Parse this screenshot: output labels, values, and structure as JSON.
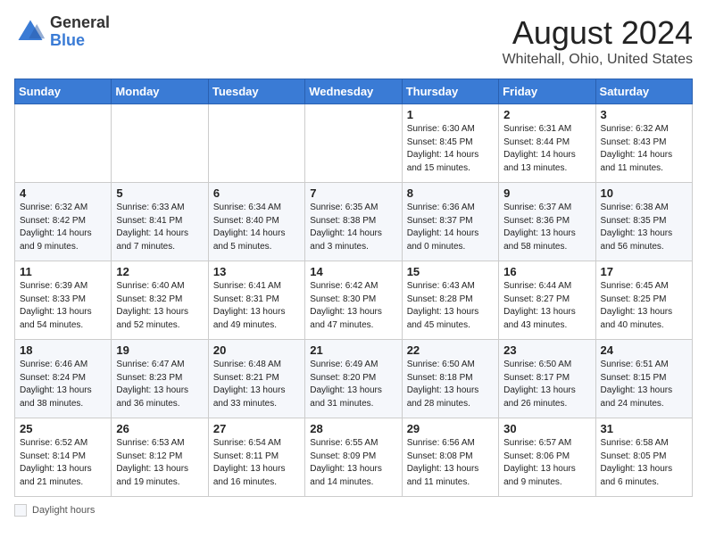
{
  "header": {
    "logo_general": "General",
    "logo_blue": "Blue",
    "title": "August 2024",
    "subtitle": "Whitehall, Ohio, United States"
  },
  "days_of_week": [
    "Sunday",
    "Monday",
    "Tuesday",
    "Wednesday",
    "Thursday",
    "Friday",
    "Saturday"
  ],
  "weeks": [
    [
      {
        "date": "",
        "info": ""
      },
      {
        "date": "",
        "info": ""
      },
      {
        "date": "",
        "info": ""
      },
      {
        "date": "",
        "info": ""
      },
      {
        "date": "1",
        "info": "Sunrise: 6:30 AM\nSunset: 8:45 PM\nDaylight: 14 hours\nand 15 minutes."
      },
      {
        "date": "2",
        "info": "Sunrise: 6:31 AM\nSunset: 8:44 PM\nDaylight: 14 hours\nand 13 minutes."
      },
      {
        "date": "3",
        "info": "Sunrise: 6:32 AM\nSunset: 8:43 PM\nDaylight: 14 hours\nand 11 minutes."
      }
    ],
    [
      {
        "date": "4",
        "info": "Sunrise: 6:32 AM\nSunset: 8:42 PM\nDaylight: 14 hours\nand 9 minutes."
      },
      {
        "date": "5",
        "info": "Sunrise: 6:33 AM\nSunset: 8:41 PM\nDaylight: 14 hours\nand 7 minutes."
      },
      {
        "date": "6",
        "info": "Sunrise: 6:34 AM\nSunset: 8:40 PM\nDaylight: 14 hours\nand 5 minutes."
      },
      {
        "date": "7",
        "info": "Sunrise: 6:35 AM\nSunset: 8:38 PM\nDaylight: 14 hours\nand 3 minutes."
      },
      {
        "date": "8",
        "info": "Sunrise: 6:36 AM\nSunset: 8:37 PM\nDaylight: 14 hours\nand 0 minutes."
      },
      {
        "date": "9",
        "info": "Sunrise: 6:37 AM\nSunset: 8:36 PM\nDaylight: 13 hours\nand 58 minutes."
      },
      {
        "date": "10",
        "info": "Sunrise: 6:38 AM\nSunset: 8:35 PM\nDaylight: 13 hours\nand 56 minutes."
      }
    ],
    [
      {
        "date": "11",
        "info": "Sunrise: 6:39 AM\nSunset: 8:33 PM\nDaylight: 13 hours\nand 54 minutes."
      },
      {
        "date": "12",
        "info": "Sunrise: 6:40 AM\nSunset: 8:32 PM\nDaylight: 13 hours\nand 52 minutes."
      },
      {
        "date": "13",
        "info": "Sunrise: 6:41 AM\nSunset: 8:31 PM\nDaylight: 13 hours\nand 49 minutes."
      },
      {
        "date": "14",
        "info": "Sunrise: 6:42 AM\nSunset: 8:30 PM\nDaylight: 13 hours\nand 47 minutes."
      },
      {
        "date": "15",
        "info": "Sunrise: 6:43 AM\nSunset: 8:28 PM\nDaylight: 13 hours\nand 45 minutes."
      },
      {
        "date": "16",
        "info": "Sunrise: 6:44 AM\nSunset: 8:27 PM\nDaylight: 13 hours\nand 43 minutes."
      },
      {
        "date": "17",
        "info": "Sunrise: 6:45 AM\nSunset: 8:25 PM\nDaylight: 13 hours\nand 40 minutes."
      }
    ],
    [
      {
        "date": "18",
        "info": "Sunrise: 6:46 AM\nSunset: 8:24 PM\nDaylight: 13 hours\nand 38 minutes."
      },
      {
        "date": "19",
        "info": "Sunrise: 6:47 AM\nSunset: 8:23 PM\nDaylight: 13 hours\nand 36 minutes."
      },
      {
        "date": "20",
        "info": "Sunrise: 6:48 AM\nSunset: 8:21 PM\nDaylight: 13 hours\nand 33 minutes."
      },
      {
        "date": "21",
        "info": "Sunrise: 6:49 AM\nSunset: 8:20 PM\nDaylight: 13 hours\nand 31 minutes."
      },
      {
        "date": "22",
        "info": "Sunrise: 6:50 AM\nSunset: 8:18 PM\nDaylight: 13 hours\nand 28 minutes."
      },
      {
        "date": "23",
        "info": "Sunrise: 6:50 AM\nSunset: 8:17 PM\nDaylight: 13 hours\nand 26 minutes."
      },
      {
        "date": "24",
        "info": "Sunrise: 6:51 AM\nSunset: 8:15 PM\nDaylight: 13 hours\nand 24 minutes."
      }
    ],
    [
      {
        "date": "25",
        "info": "Sunrise: 6:52 AM\nSunset: 8:14 PM\nDaylight: 13 hours\nand 21 minutes."
      },
      {
        "date": "26",
        "info": "Sunrise: 6:53 AM\nSunset: 8:12 PM\nDaylight: 13 hours\nand 19 minutes."
      },
      {
        "date": "27",
        "info": "Sunrise: 6:54 AM\nSunset: 8:11 PM\nDaylight: 13 hours\nand 16 minutes."
      },
      {
        "date": "28",
        "info": "Sunrise: 6:55 AM\nSunset: 8:09 PM\nDaylight: 13 hours\nand 14 minutes."
      },
      {
        "date": "29",
        "info": "Sunrise: 6:56 AM\nSunset: 8:08 PM\nDaylight: 13 hours\nand 11 minutes."
      },
      {
        "date": "30",
        "info": "Sunrise: 6:57 AM\nSunset: 8:06 PM\nDaylight: 13 hours\nand 9 minutes."
      },
      {
        "date": "31",
        "info": "Sunrise: 6:58 AM\nSunset: 8:05 PM\nDaylight: 13 hours\nand 6 minutes."
      }
    ]
  ],
  "footer": {
    "legend_label": "Daylight hours"
  }
}
